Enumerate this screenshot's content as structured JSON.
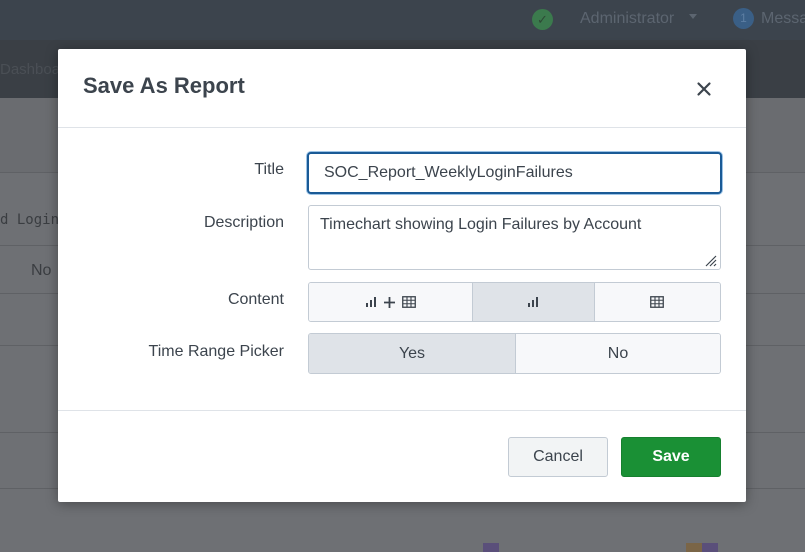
{
  "background": {
    "admin_label": "Administrator",
    "messages_count": "1",
    "messages_label": "Messages",
    "nav_partial": "Dashboards",
    "column_partial": "d Login",
    "cell_partial": "No"
  },
  "modal": {
    "title": "Save As Report",
    "close_icon": "close-icon",
    "fields": {
      "title_label": "Title",
      "title_value": "SOC_Report_WeeklyLoginFailures",
      "description_label": "Description",
      "description_value": "Timechart showing Login Failures by Account",
      "content_label": "Content",
      "content_options": [
        {
          "icons": [
            "bar-chart-icon",
            "plus-icon",
            "table-icon"
          ],
          "selected": false
        },
        {
          "icons": [
            "bar-chart-icon"
          ],
          "selected": true
        },
        {
          "icons": [
            "table-icon"
          ],
          "selected": false
        }
      ],
      "time_range_label": "Time Range Picker",
      "time_range_options": [
        {
          "label": "Yes",
          "selected": true
        },
        {
          "label": "No",
          "selected": false
        }
      ]
    },
    "buttons": {
      "cancel": "Cancel",
      "save": "Save"
    }
  },
  "colors": {
    "primary_button": "#1a9035",
    "focus_border": "#1a5a96",
    "text": "#3c444d"
  }
}
